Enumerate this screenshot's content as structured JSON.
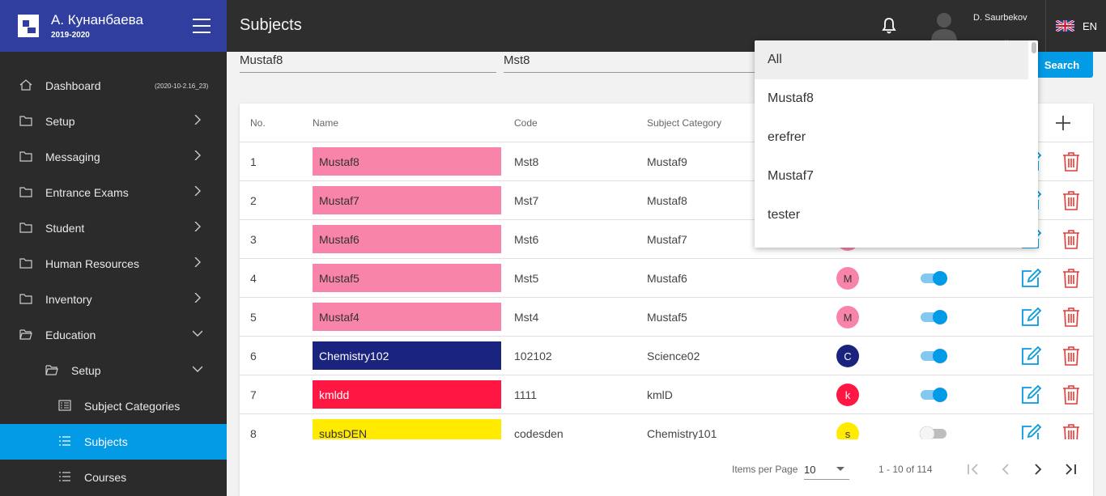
{
  "brand": {
    "name": "А. Кунанбаева",
    "year": "2019-2020"
  },
  "sidebar": {
    "version": "(2020-10-2.16_23)",
    "items": [
      {
        "label": "Dashboard"
      },
      {
        "label": "Setup"
      },
      {
        "label": "Messaging"
      },
      {
        "label": "Entrance Exams"
      },
      {
        "label": "Student"
      },
      {
        "label": "Human Resources"
      },
      {
        "label": "Inventory"
      },
      {
        "label": "Education"
      },
      {
        "label": "Setup"
      },
      {
        "label": "Subject Categories"
      },
      {
        "label": "Subjects"
      },
      {
        "label": "Courses"
      }
    ]
  },
  "header": {
    "title": "Subjects",
    "user": "D. Saurbekov",
    "caret": "⌄",
    "lang": "EN"
  },
  "filters": {
    "name_value": "Mustaf8",
    "code_value": "Mst8",
    "search_label": "Search"
  },
  "table": {
    "columns": {
      "no": "No.",
      "name": "Name",
      "code": "Code",
      "category": "Subject Category"
    },
    "rows": [
      {
        "no": "1",
        "name": "Mustaf8",
        "code": "Mst8",
        "category": "Mustaf9",
        "initial": "M",
        "color": "#f984aa",
        "text_color": "#333333",
        "active": true
      },
      {
        "no": "2",
        "name": "Mustaf7",
        "code": "Mst7",
        "category": "Mustaf8",
        "initial": "M",
        "color": "#f984aa",
        "text_color": "#333333",
        "active": true
      },
      {
        "no": "3",
        "name": "Mustaf6",
        "code": "Mst6",
        "category": "Mustaf7",
        "initial": "M",
        "color": "#f984aa",
        "text_color": "#333333",
        "active": true
      },
      {
        "no": "4",
        "name": "Mustaf5",
        "code": "Mst5",
        "category": "Mustaf6",
        "initial": "M",
        "color": "#f984aa",
        "text_color": "#333333",
        "active": true
      },
      {
        "no": "5",
        "name": "Mustaf4",
        "code": "Mst4",
        "category": "Mustaf5",
        "initial": "M",
        "color": "#f984aa",
        "text_color": "#333333",
        "active": true
      },
      {
        "no": "6",
        "name": "Chemistry102",
        "code": "102102",
        "category": "Science02",
        "initial": "C",
        "color": "#1a237e",
        "text_color": "#ffffff",
        "active": true
      },
      {
        "no": "7",
        "name": "kmldd",
        "code": "1111",
        "category": "kmlD",
        "initial": "k",
        "color": "#ff1744",
        "text_color": "#ffffff",
        "active": true
      },
      {
        "no": "8",
        "name": "subsDEN",
        "code": "codesden",
        "category": "Chemistry101",
        "initial": "s",
        "color": "#ffea00",
        "text_color": "#333333",
        "active": false
      }
    ]
  },
  "pagination": {
    "items_per_page_label": "Items per Page",
    "page_size": "10",
    "range": "1 - 10 of 114"
  },
  "dropdown": {
    "options": [
      "All",
      "Mustaf8",
      "erefrer",
      "Mustaf7",
      "tester"
    ]
  },
  "colors": {
    "accent": "#039be5",
    "brand": "#303f9f",
    "sidebar": "#2b2b2b",
    "delete": "#e53935"
  }
}
